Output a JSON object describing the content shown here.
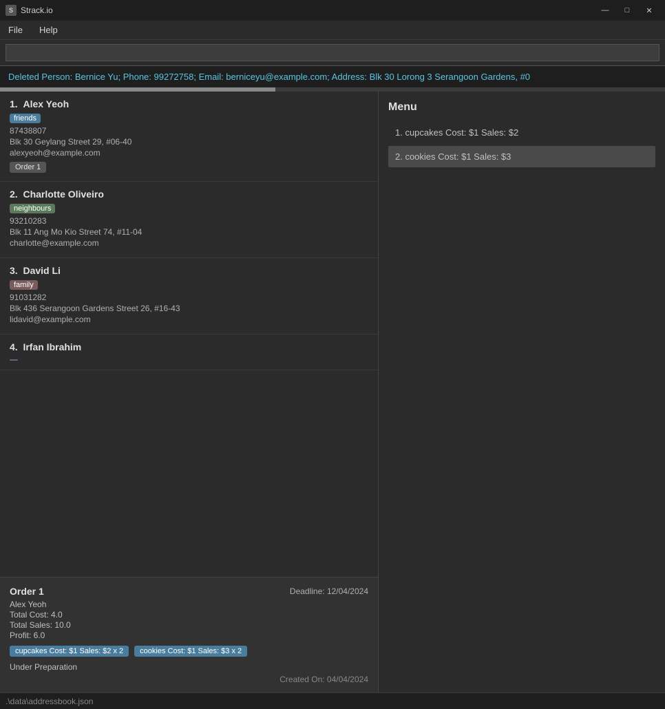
{
  "titleBar": {
    "appName": "Strack.io",
    "icon": "S"
  },
  "menuBar": {
    "items": [
      "File",
      "Help"
    ]
  },
  "search": {
    "placeholder": "",
    "value": ""
  },
  "deletedBanner": {
    "text": "Deleted Person: Bernice Yu; Phone: 99272758; Email: berniceyu@example.com; Address: Blk 30 Lorong 3 Serangoon Gardens, #0"
  },
  "contacts": [
    {
      "number": "1.",
      "name": "Alex Yeoh",
      "tag": "friends",
      "tagClass": "tag-friends",
      "phone": "87438807",
      "address": "Blk 30 Geylang Street 29, #06-40",
      "email": "alexyeoh@example.com",
      "order": "Order 1",
      "selected": false
    },
    {
      "number": "2.",
      "name": "Charlotte Oliveiro",
      "tag": "neighbours",
      "tagClass": "tag-neighbours",
      "phone": "93210283",
      "address": "Blk 11 Ang Mo Kio Street 74, #11-04",
      "email": "charlotte@example.com",
      "order": null,
      "selected": false
    },
    {
      "number": "3.",
      "name": "David Li",
      "tag": "family",
      "tagClass": "tag-family",
      "phone": "91031282",
      "address": "Blk 436 Serangoon Gardens Street 26, #16-43",
      "email": "lidavid@example.com",
      "order": null,
      "selected": false
    },
    {
      "number": "4.",
      "name": "Irfan Ibrahim",
      "tag": "",
      "tagClass": "",
      "phone": "",
      "address": "",
      "email": "",
      "order": null,
      "selected": false
    }
  ],
  "menu": {
    "title": "Menu",
    "products": [
      {
        "number": "1.",
        "text": "cupcakes  Cost: $1  Sales: $2",
        "selected": false
      },
      {
        "number": "2.",
        "text": "cookies  Cost: $1  Sales: $3",
        "selected": true
      }
    ]
  },
  "orderDetail": {
    "title": "Order 1",
    "deadline": "Deadline: 12/04/2024",
    "person": "Alex Yeoh",
    "totalCost": "Total Cost: 4.0",
    "totalSales": "Total Sales: 10.0",
    "profit": "Profit: 6.0",
    "items": [
      "cupcakes Cost: $1 Sales: $2 x 2",
      "cookies Cost: $1 Sales: $3 x 2"
    ],
    "status": "Under Preparation",
    "createdOn": "Created On: 04/04/2024"
  },
  "statusBar": {
    "text": ".\\data\\addressbook.json"
  },
  "windowControls": {
    "minimize": "—",
    "maximize": "□",
    "close": "✕"
  }
}
